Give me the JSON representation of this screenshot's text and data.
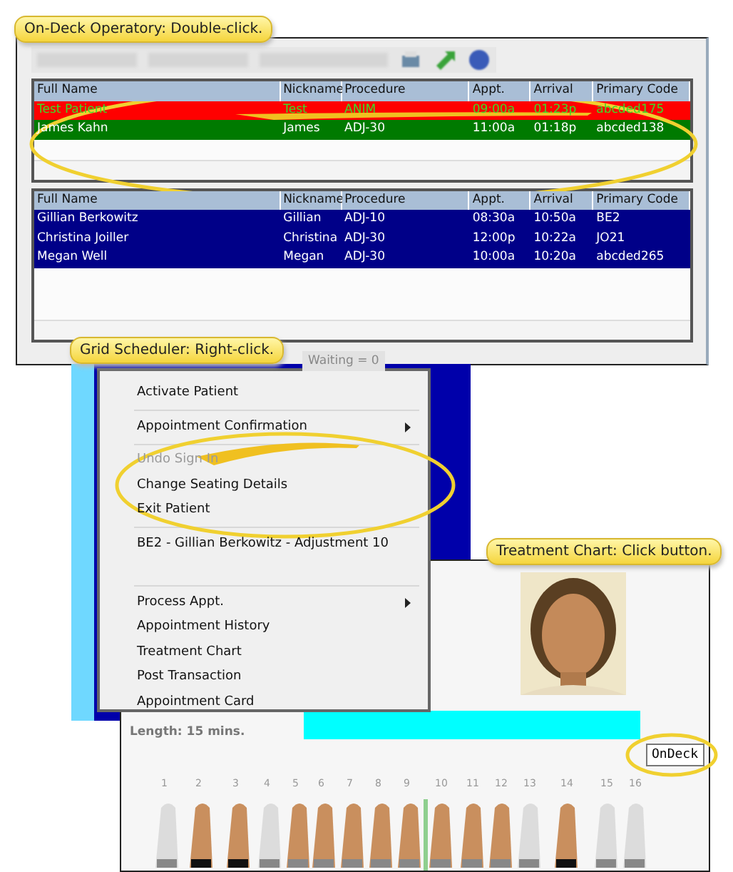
{
  "callouts": [
    {
      "text": "On-Deck Operatory: Double-click."
    },
    {
      "text": "Grid Scheduler: Right-click."
    },
    {
      "text": "Treatment Chart: Click button."
    }
  ],
  "ondeck": {
    "columns": [
      "Full Name",
      "Nickname",
      "Procedure",
      "Appt.",
      "Arrival",
      "Primary Code"
    ],
    "rows": [
      {
        "cells": [
          "Test Patient",
          "Test",
          "ANIM",
          "09:00a",
          "01:23p",
          "abcded175"
        ],
        "color": "#ff0000"
      },
      {
        "cells": [
          "James Kahn",
          "James",
          "ADJ-30",
          "11:00a",
          "01:18p",
          "abcded138"
        ],
        "color": "#007a00"
      }
    ]
  },
  "waiting": {
    "columns": [
      "Full Name",
      "Nickname",
      "Procedure",
      "Appt.",
      "Arrival",
      "Primary Code"
    ],
    "rows": [
      {
        "cells": [
          "Gillian Berkowitz",
          "Gillian",
          "ADJ-10",
          "08:30a",
          "10:50a",
          "BE2"
        ],
        "selected": true
      },
      {
        "cells": [
          "Christina Joiller",
          "Christina",
          "ADJ-30",
          "12:00p",
          "10:22a",
          "JO21"
        ],
        "selected": true
      },
      {
        "cells": [
          "Megan Well",
          "Megan",
          "ADJ-30",
          "10:00a",
          "10:20a",
          "abcded265"
        ],
        "selected": true
      }
    ]
  },
  "status_bar": {
    "waiting": "Waiting = 0"
  },
  "context_menu": [
    {
      "kind": "item",
      "label": "Activate Patient",
      "disabled": false,
      "submenu": false
    },
    {
      "kind": "separator"
    },
    {
      "kind": "item",
      "label": "Appointment Confirmation",
      "disabled": false,
      "submenu": true
    },
    {
      "kind": "separator"
    },
    {
      "kind": "item",
      "label": "Undo Sign In",
      "disabled": true,
      "submenu": false
    },
    {
      "kind": "item",
      "label": "Change Seating Details",
      "disabled": false,
      "submenu": false
    },
    {
      "kind": "item",
      "label": "Exit Patient",
      "disabled": false,
      "submenu": false
    },
    {
      "kind": "separator"
    },
    {
      "kind": "item",
      "label": "BE2 - Gillian Berkowitz - Adjustment 10",
      "disabled": false,
      "submenu": false
    },
    {
      "kind": "blank"
    },
    {
      "kind": "separator"
    },
    {
      "kind": "item",
      "label": "Process Appt.",
      "disabled": false,
      "submenu": true
    },
    {
      "kind": "item",
      "label": "Appointment History",
      "disabled": false,
      "submenu": false
    },
    {
      "kind": "item",
      "label": "Treatment Chart",
      "disabled": false,
      "submenu": false
    },
    {
      "kind": "item",
      "label": "Post Transaction",
      "disabled": false,
      "submenu": false
    },
    {
      "kind": "item",
      "label": "Appointment Card",
      "disabled": false,
      "submenu": false
    }
  ],
  "treatment_chart": {
    "length": "Length: 15 mins.",
    "button": "OnDeck",
    "tooth_numbers": [
      "1",
      "2",
      "3",
      "4",
      "5",
      "6",
      "7",
      "8",
      "9",
      "10",
      "11",
      "12",
      "13",
      "14",
      "15",
      "16"
    ]
  }
}
